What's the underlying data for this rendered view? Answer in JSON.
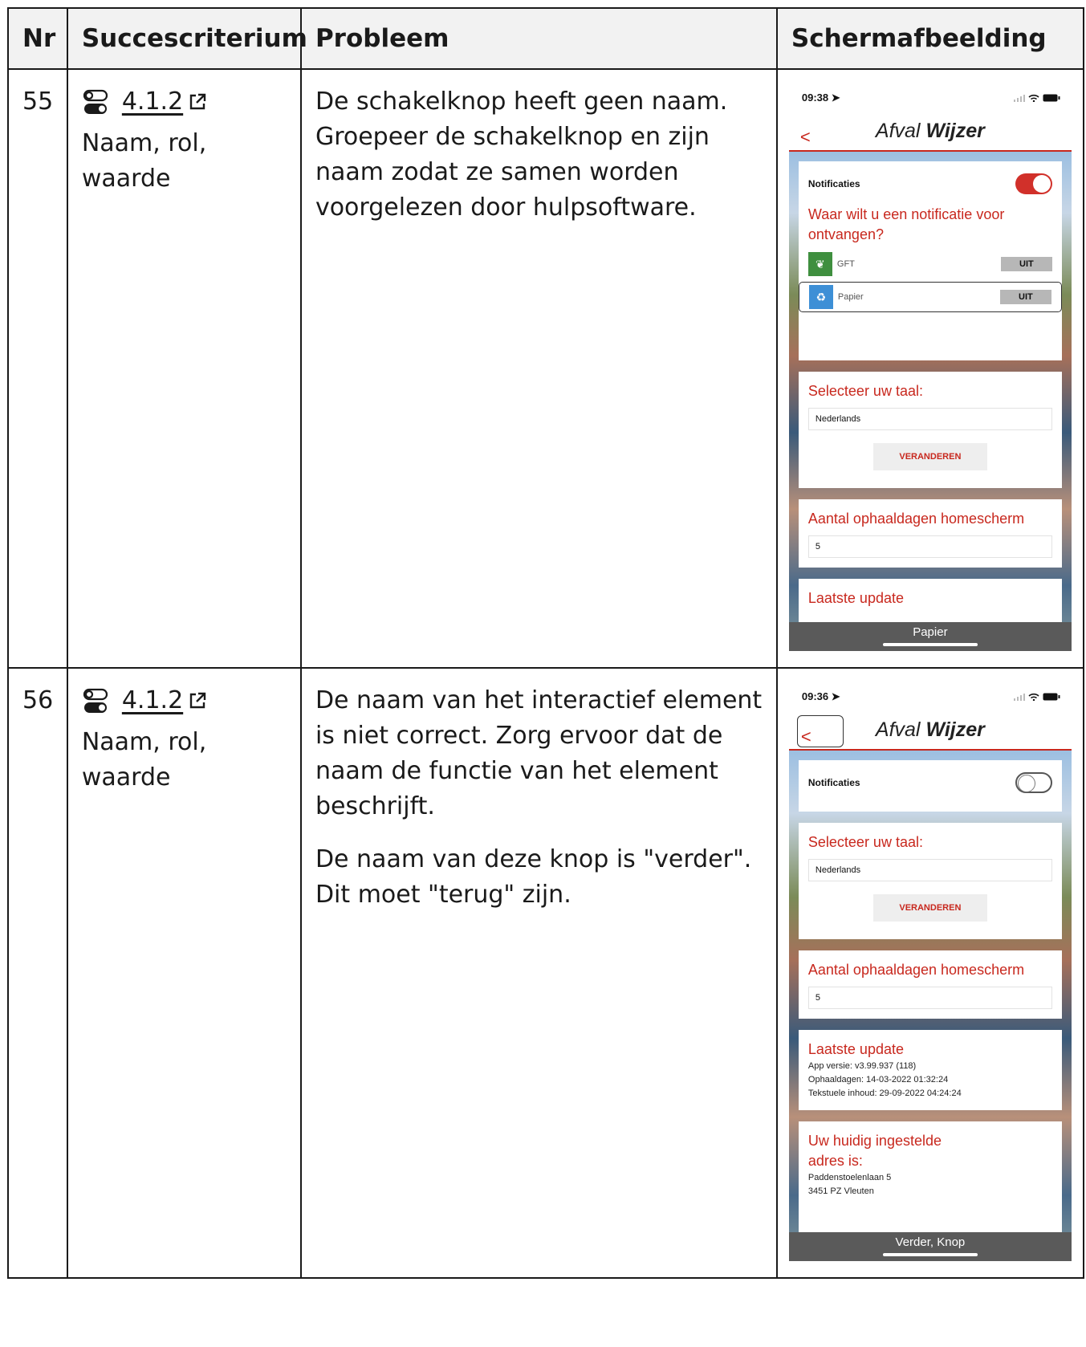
{
  "headers": {
    "nr": "Nr",
    "criterion": "Succescriterium",
    "problem": "Probleem",
    "screenshot": "Schermafbeelding"
  },
  "rows": [
    {
      "nr": "55",
      "sc_number": "4.1.2",
      "sc_name": "Naam, rol, waarde",
      "problem": [
        "De schakelknop heeft geen naam. Groepeer de schakelknop en zijn naam zodat ze samen worden voorgelezen door hulpsoftware."
      ],
      "phone": {
        "time": "09:38",
        "logo_left": "Afval",
        "logo_right": "Wijzer",
        "notifications_label": "Notificaties",
        "question": "Waar wilt u een notificatie voor ontvangen?",
        "items": [
          {
            "label": "GFT",
            "state": "UIT",
            "color": "#3f8f3f"
          },
          {
            "label": "Papier",
            "state": "UIT",
            "color": "#3d8fd6"
          }
        ],
        "language_title": "Selecteer uw taal:",
        "language_value": "Nederlands",
        "change_button": "VERANDEREN",
        "days_title": "Aantal ophaaldagen homescherm",
        "days_value": "5",
        "update_title": "Laatste update",
        "voiceover": "Papier"
      }
    },
    {
      "nr": "56",
      "sc_number": "4.1.2",
      "sc_name": "Naam, rol, waarde",
      "problem": [
        "De naam van het interactief element is niet correct. Zorg ervoor dat de naam de functie van het element beschrijft.",
        "De naam van deze knop is \"verder\". Dit moet \"terug\" zijn."
      ],
      "phone": {
        "time": "09:36",
        "logo_left": "Afval",
        "logo_right": "Wijzer",
        "notifications_label": "Notificaties",
        "language_title": "Selecteer uw taal:",
        "language_value": "Nederlands",
        "change_button": "VERANDEREN",
        "days_title": "Aantal ophaaldagen homescherm",
        "days_value": "5",
        "update_title": "Laatste update",
        "update_lines": [
          "App versie: v3.99.937 (118)",
          "Ophaaldagen: 14-03-2022 01:32:24",
          "Tekstuele inhoud: 29-09-2022 04:24:24"
        ],
        "address_title": "Uw huidig ingestelde adres is:",
        "address_lines": [
          "Paddenstoelenlaan 5",
          "3451 PZ Vleuten"
        ],
        "voiceover": "Verder, Knop"
      }
    }
  ]
}
